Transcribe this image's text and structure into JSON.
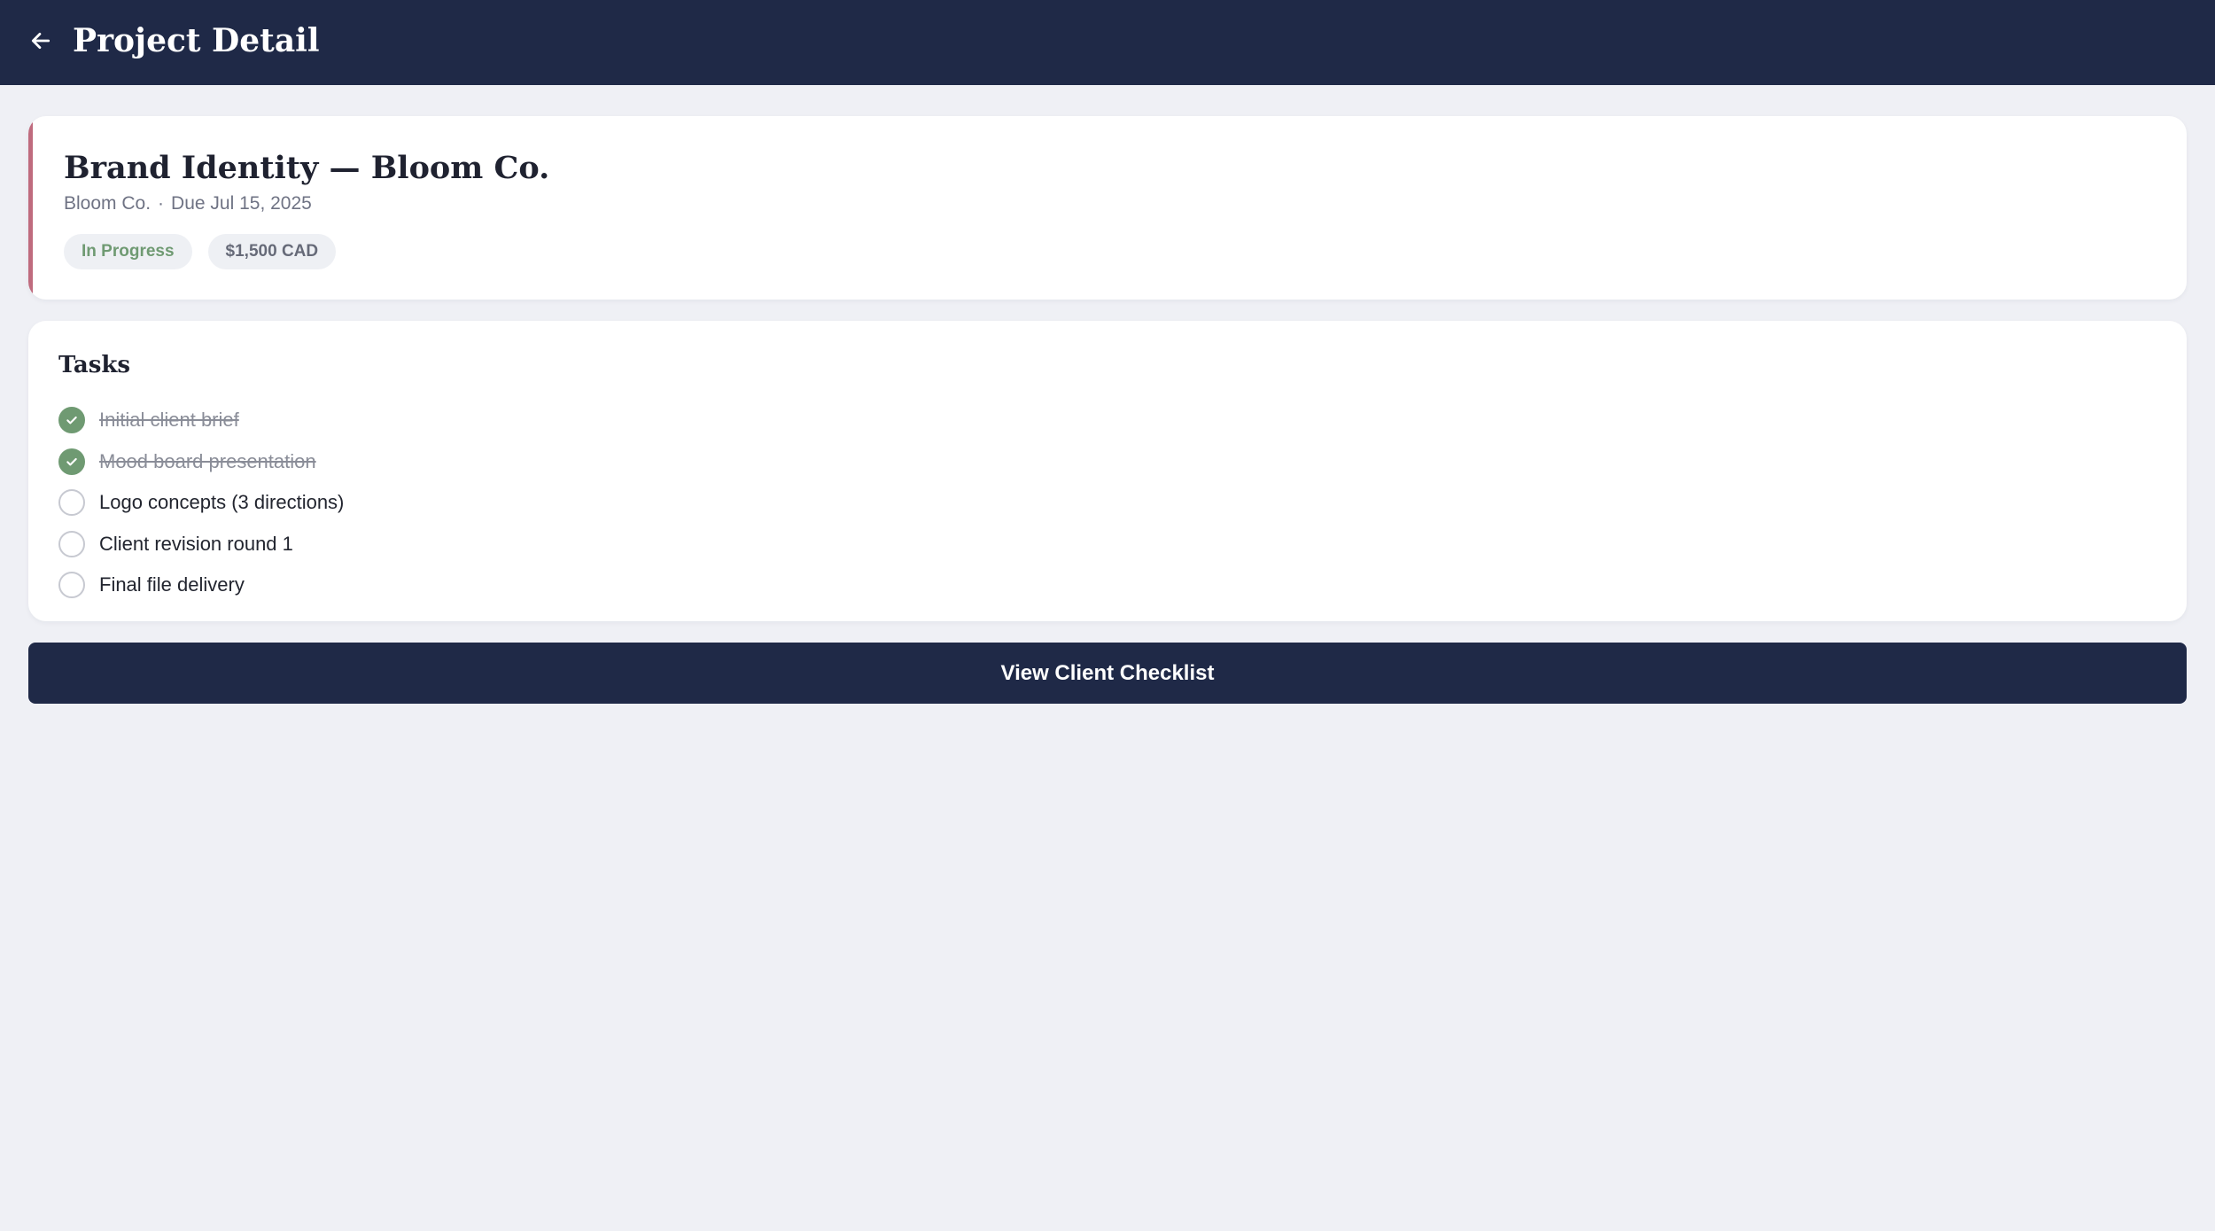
{
  "header": {
    "title": "Project Detail",
    "back_icon": "arrow-left-icon",
    "background": "#1f2947"
  },
  "project": {
    "title": "Brand Identity — Bloom Co.",
    "client": "Bloom Co.",
    "separator": "·",
    "due": "Due Jul 15, 2025",
    "accent_color": "#bf6b7e",
    "status": "In Progress",
    "status_color": "#6f9a72",
    "budget": "$1,500 CAD"
  },
  "tasks": {
    "heading": "Tasks",
    "items": [
      {
        "label": "Initial client brief",
        "done": true
      },
      {
        "label": "Mood board presentation",
        "done": true
      },
      {
        "label": "Logo concepts (3 directions)",
        "done": false
      },
      {
        "label": "Client revision round 1",
        "done": false
      },
      {
        "label": "Final file delivery",
        "done": false
      }
    ]
  },
  "actions": {
    "checklist_label": "View Client Checklist"
  }
}
